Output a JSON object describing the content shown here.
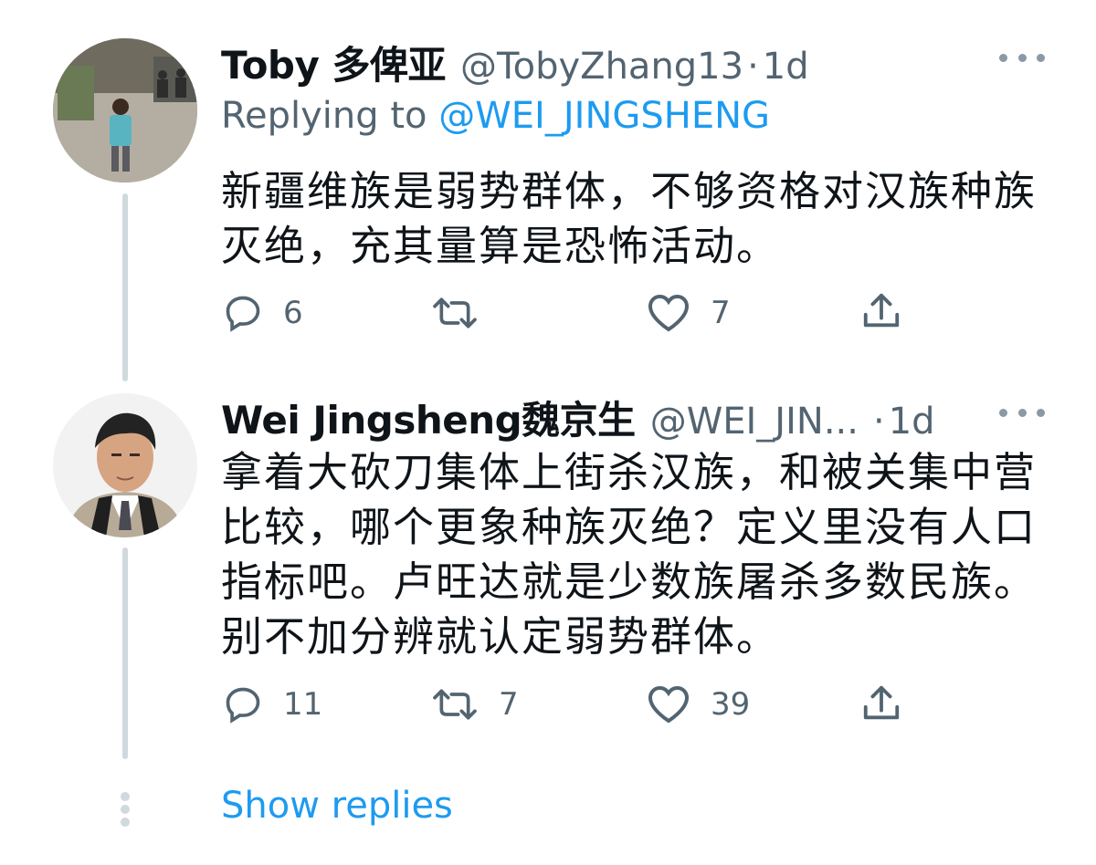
{
  "tweets": [
    {
      "name": "Toby 多俾亚",
      "handle": "@TobyZhang13",
      "separator": "·",
      "time": "1d",
      "replying_prefix": "Replying to",
      "replying_handle": "@WEI_JINGSHENG",
      "text": "新疆维族是弱势群体，不够资格对汉族种族灭绝，充其量算是恐怖活动。",
      "replies": "6",
      "retweets": "",
      "likes": "7"
    },
    {
      "name": "Wei Jingsheng魏京生",
      "handle": "@WEI_JIN...",
      "separator": "·",
      "time": "1d",
      "text": "拿着大砍刀集体上街杀汉族，和被关集中营比较，哪个更象种族灭绝？定义里没有人口指标吧。卢旺达就是少数族屠杀多数民族。别不加分辨就认定弱势群体。",
      "replies": "11",
      "retweets": "7",
      "likes": "39"
    }
  ],
  "show_replies": "Show replies",
  "colors": {
    "accent": "#1d9bf0",
    "text": "#0f1419",
    "secondary": "#536471",
    "thread_line": "#cfd9de"
  },
  "icons": [
    "reply-icon",
    "retweet-icon",
    "like-icon",
    "share-icon",
    "more-icon"
  ]
}
